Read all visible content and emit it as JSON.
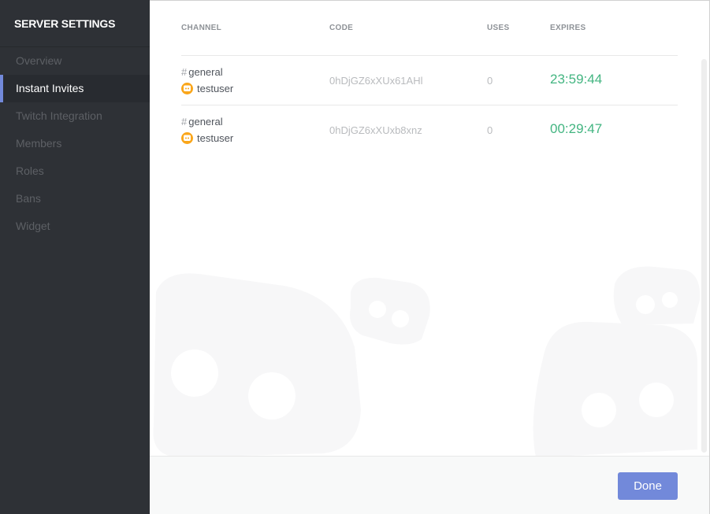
{
  "sidebar": {
    "title": "SERVER SETTINGS",
    "items": [
      {
        "label": "Overview"
      },
      {
        "label": "Instant Invites"
      },
      {
        "label": "Twitch Integration"
      },
      {
        "label": "Members"
      },
      {
        "label": "Roles"
      },
      {
        "label": "Bans"
      },
      {
        "label": "Widget"
      }
    ],
    "active": "Instant Invites"
  },
  "table": {
    "headers": {
      "channel": "CHANNEL",
      "code": "CODE",
      "uses": "USES",
      "expires": "EXPIRES"
    },
    "rows": [
      {
        "hash": "#",
        "channel": "general",
        "user": "testuser",
        "code": "0hDjGZ6xXUx61AHl",
        "uses": "0",
        "expires": "23:59:44"
      },
      {
        "hash": "#",
        "channel": "general",
        "user": "testuser",
        "code": "0hDjGZ6xXUxb8xnz",
        "uses": "0",
        "expires": "00:29:47"
      }
    ]
  },
  "footer": {
    "done_label": "Done"
  },
  "colors": {
    "accent": "#7289da",
    "timer": "#43b581",
    "avatar": "#faa61a",
    "sidebar_bg": "#2e3136"
  }
}
